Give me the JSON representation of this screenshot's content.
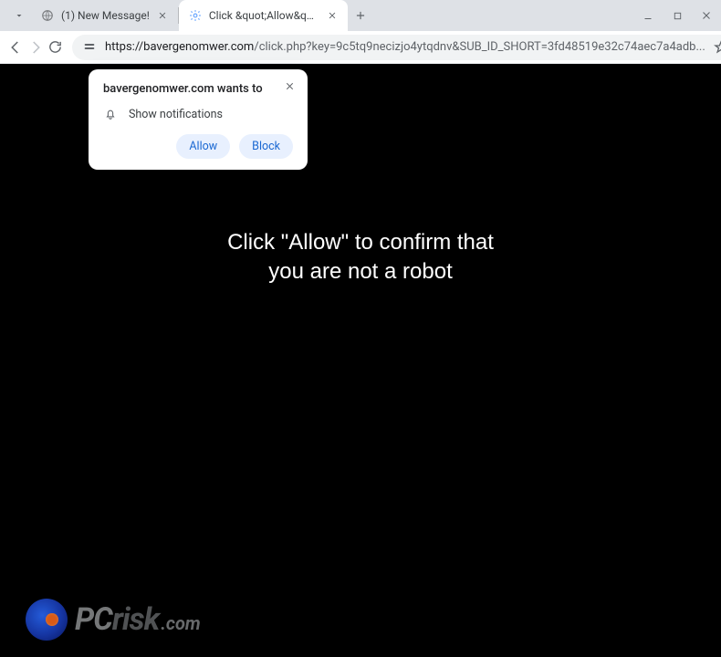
{
  "tabs": [
    {
      "label": "(1) New Message!",
      "favicon": "globe"
    },
    {
      "label": "Click &quot;Allow&quot;",
      "favicon": "gear"
    }
  ],
  "url": {
    "scheme": "https://",
    "host": "bavergenomwer.com",
    "path": "/click.php?key=9c5tq9necizjo4ytqdnv&SUB_ID_SHORT=3fd48519e32c74aec7a4adb..."
  },
  "prompt": {
    "header": "bavergenomwer.com wants to",
    "permission": "Show notifications",
    "allow": "Allow",
    "block": "Block"
  },
  "scam_message": "Click \"Allow\" to confirm that you are not a robot",
  "watermark": {
    "pc": "PC",
    "risk": "risk",
    "com": ".com"
  }
}
